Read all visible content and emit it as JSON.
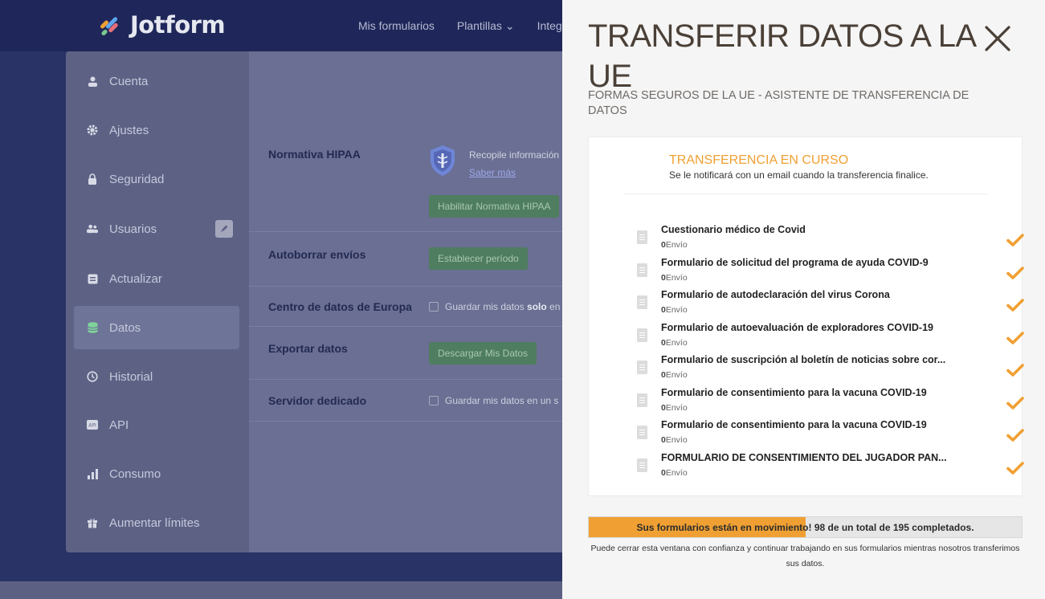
{
  "app": {
    "logo_text": "Jotform",
    "nav": [
      "Mis formularios",
      "Plantillas ⌄",
      "Integ"
    ],
    "colors": {
      "accent": "#f0a033",
      "panel_title": "#4a4037",
      "bg_overlay": "#2a3365"
    }
  },
  "sidebar": {
    "items": [
      {
        "label": "Cuenta",
        "icon": "person-icon"
      },
      {
        "label": "Ajustes",
        "icon": "gear-icon"
      },
      {
        "label": "Seguridad",
        "icon": "lock-icon"
      },
      {
        "label": "Usuarios",
        "icon": "users-icon"
      },
      {
        "label": "Actualizar",
        "icon": "upgrade-icon"
      },
      {
        "label": "Datos",
        "icon": "database-icon"
      },
      {
        "label": "Historial",
        "icon": "history-icon"
      },
      {
        "label": "API",
        "icon": "api-icon"
      },
      {
        "label": "Consumo",
        "icon": "bar-chart-icon"
      },
      {
        "label": "Aumentar límites",
        "icon": "gift-icon"
      }
    ]
  },
  "settings": {
    "hipaa": {
      "label": "Normativa HIPAA",
      "text": "Recopile información",
      "link": "Saber más",
      "button": "Habilitar Normativa HIPAA"
    },
    "autodelete": {
      "label": "Autoborrar envíos",
      "button": "Establecer período"
    },
    "eu_center": {
      "label": "Centro de datos de Europa",
      "checkbox_pre": "Guardar mis datos ",
      "checkbox_bold": "solo",
      "checkbox_post": " en"
    },
    "export": {
      "label": "Exportar datos",
      "button": "Descargar Mis Datos"
    },
    "dedicated": {
      "label": "Servidor dedicado",
      "checkbox": "Guardar mis datos en un s"
    }
  },
  "modal": {
    "title": "TRANSFERIR DATOS A LA UE",
    "subtitle": "FORMAS SEGUROS DE LA UE - ASISTENTE DE TRANSFERENCIA DE DATOS",
    "status_title": "TRANSFERENCIA EN CURSO",
    "status_message": "Se le notificará con un email cuando la transferencia finalice.",
    "forms": [
      {
        "name": "Cuestionario médico de Covid",
        "count": "0",
        "unit": "Envío"
      },
      {
        "name": "Formulario de solicitud del programa de ayuda COVID-9",
        "count": "0",
        "unit": "Envío"
      },
      {
        "name": "Formulario de autodeclaración del virus Corona",
        "count": "0",
        "unit": "Envío"
      },
      {
        "name": "Formulario de autoevaluación de exploradores COVID-19",
        "count": "0",
        "unit": "Envío"
      },
      {
        "name": "Formulario de suscripción al boletín de noticias sobre cor...",
        "count": "0",
        "unit": "Envío"
      },
      {
        "name": "Formulario de consentimiento para la vacuna COVID-19",
        "count": "0",
        "unit": "Envío"
      },
      {
        "name": "Formulario de consentimiento para la vacuna COVID-19",
        "count": "0",
        "unit": "Envío"
      },
      {
        "name": "FORMULARIO DE CONSENTIMIENTO DEL JUGADOR PAN...",
        "count": "0",
        "unit": "Envío"
      }
    ],
    "progress": {
      "fraction": 0.5,
      "text_part1": "Sus formularios están en movimiento",
      "text_part2": "! 98 de un total de 195 completados."
    },
    "footer_note": "Puede cerrar esta ventana con confianza y continuar trabajando en sus formularios mientras nosotros transferimos sus datos."
  }
}
